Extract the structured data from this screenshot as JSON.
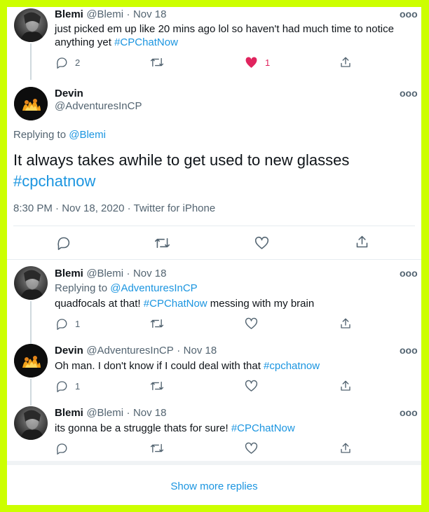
{
  "tweets": [
    {
      "name": "Blemi",
      "handle": "@Blemi",
      "sep": "·",
      "date": "Nov 18",
      "text_line1": "just picked em up like 20 mins ago lol so haven't had much time to notice",
      "text_line2_plain": "anything yet ",
      "text_line2_hashtag": "#CPChatNow",
      "reply_count": "2",
      "like_count": "1"
    },
    {
      "name": "Devin",
      "handle": "@AdventuresInCP",
      "replying_prefix": "Replying to ",
      "replying_to": "@Blemi",
      "text_line1": "It always takes awhile to get used to new glasses",
      "text_line2_hashtag": "#cpchatnow",
      "meta": "8:30 PM · Nov 18, 2020 · Twitter for iPhone"
    },
    {
      "name": "Blemi",
      "handle": "@Blemi",
      "sep": "·",
      "date": "Nov 18",
      "replying_prefix": "Replying to ",
      "replying_to": "@AdventuresInCP",
      "text_plain1": "quadfocals at that! ",
      "text_hashtag": "#CPChatNow",
      "text_plain2": " messing with my brain",
      "reply_count": "1"
    },
    {
      "name": "Devin",
      "handle": "@AdventuresInCP",
      "sep": "·",
      "date": "Nov 18",
      "text_plain1": "Oh man. I don't know if I could deal with that ",
      "text_hashtag": "#cpchatnow",
      "reply_count": "1"
    },
    {
      "name": "Blemi",
      "handle": "@Blemi",
      "sep": "·",
      "date": "Nov 18",
      "text_plain1": "its gonna be a struggle thats for sure! ",
      "text_hashtag": "#CPChatNow"
    }
  ],
  "more_glyph": "ooo",
  "show_more": "Show more replies",
  "icons": [
    "reply-icon",
    "retweet-icon",
    "heart-icon",
    "share-icon",
    "more-options-icon"
  ],
  "colors": {
    "border": "#ccff00",
    "link": "#1b95e0",
    "like": "#e0245e",
    "muted": "#536471"
  }
}
